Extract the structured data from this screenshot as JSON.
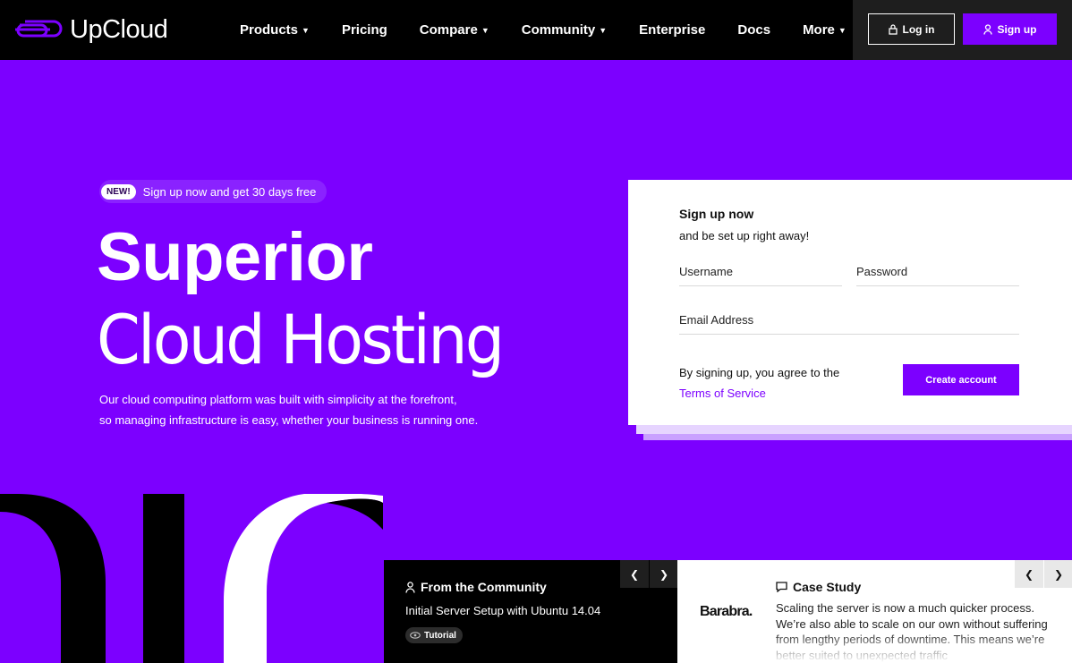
{
  "brand": {
    "logo_text": "UpCloud",
    "accent": "#7c00ff"
  },
  "nav": {
    "items": [
      {
        "label": "Products",
        "has_dropdown": true
      },
      {
        "label": "Pricing",
        "has_dropdown": false
      },
      {
        "label": "Compare",
        "has_dropdown": true
      },
      {
        "label": "Community",
        "has_dropdown": true
      },
      {
        "label": "Enterprise",
        "has_dropdown": false
      },
      {
        "label": "Docs",
        "has_dropdown": false
      },
      {
        "label": "More",
        "has_dropdown": true
      }
    ],
    "login_label": "Log in",
    "signup_label": "Sign up",
    "dropdown_icon": "chevron-down-icon"
  },
  "hero": {
    "badge": "NEW!",
    "promo": "Sign up now and get 30 days free",
    "title_bold": "Superior",
    "title_light": "Cloud Hosting",
    "description_line1": "Our cloud computing platform was built with simplicity at the forefront,",
    "description_line2": "so managing infrastructure is easy, whether your business is running one."
  },
  "signup_form": {
    "title": "Sign up now",
    "subtitle": "and be set up right away!",
    "username_label": "Username",
    "password_label": "Password",
    "email_label": "Email Address",
    "terms_prefix": "By signing up, you agree to the",
    "terms_link": "Terms of Service",
    "submit_label": "Create account"
  },
  "community": {
    "title": "From the Community",
    "item": "Initial Server Setup with Ubuntu 14.04",
    "tag": "Tutorial"
  },
  "case_study": {
    "title": "Case Study",
    "brand": "Barabra.",
    "text": "Scaling the server is now a much quicker process. We’re also able to scale on our own without suffering from lengthy periods of downtime. This means we’re better suited to unexpected traffic"
  }
}
